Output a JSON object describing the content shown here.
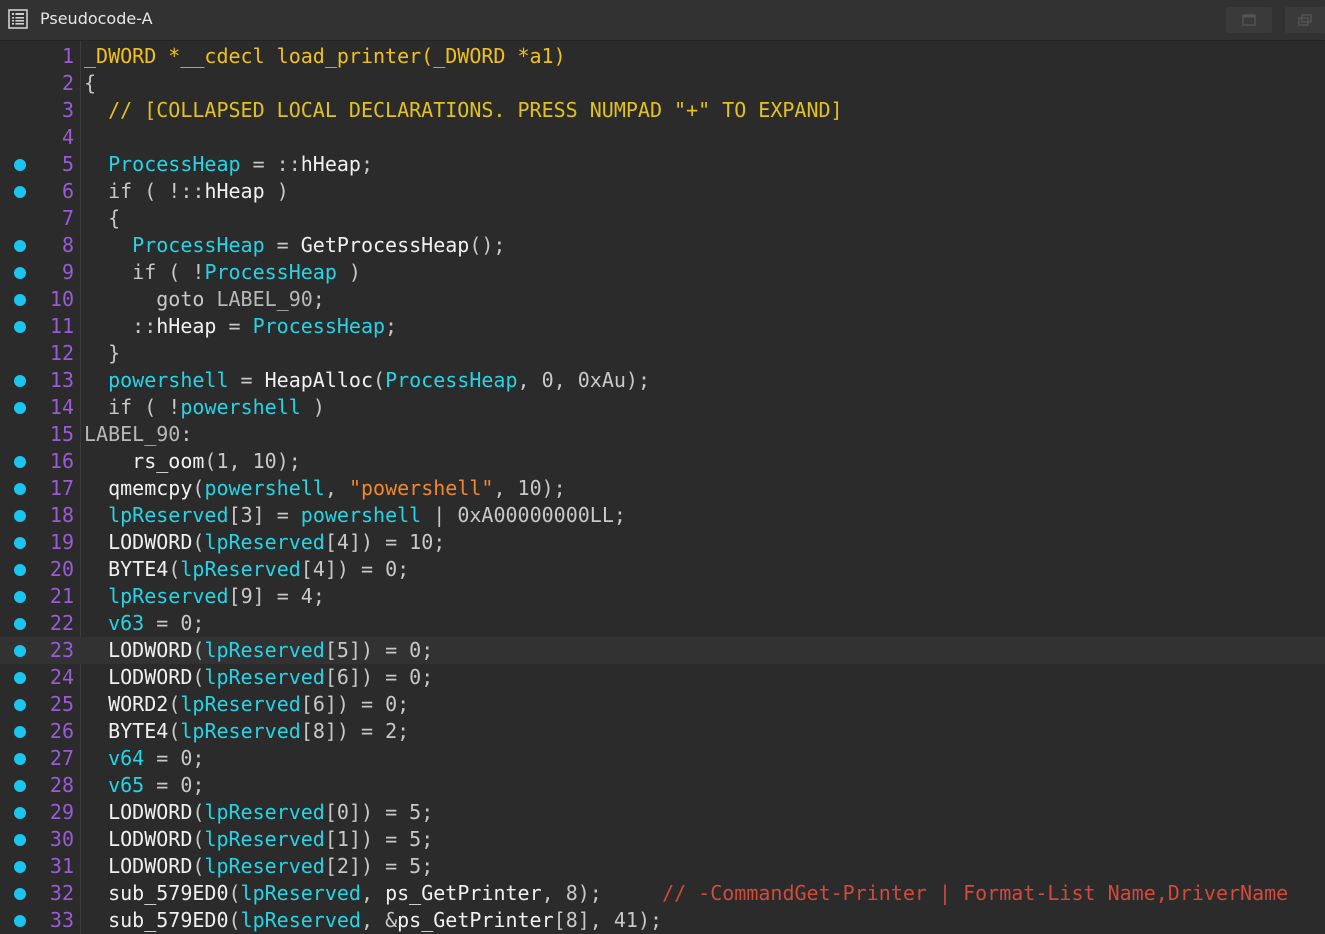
{
  "window": {
    "title": "Pseudocode-A"
  },
  "icons": {
    "title": "pseudocode-window-icon",
    "restore": "restore-window-icon",
    "float": "float-window-icon",
    "breakpoint_marker": "statement-dot-icon"
  },
  "colors": {
    "background": "#2b2b2b",
    "line_number": "#9a5cd6",
    "identifier": "#25d4e6",
    "collapsed_comment": "#e2c222",
    "inline_comment": "#d24a3c",
    "string": "#f0882c",
    "dot": "#1ac6f0"
  },
  "code": {
    "highlighted_line": 23,
    "lines": [
      {
        "n": "1",
        "dot": false,
        "segs": [
          {
            "c": "sig",
            "t": "_DWORD *__cdecl load_printer(_DWORD *a1)"
          }
        ]
      },
      {
        "n": "2",
        "dot": false,
        "segs": [
          {
            "c": "op",
            "t": "{"
          }
        ]
      },
      {
        "n": "3",
        "dot": false,
        "segs": [
          {
            "c": "op",
            "t": "  "
          },
          {
            "c": "cmt",
            "t": "// [COLLAPSED LOCAL DECLARATIONS. PRESS NUMPAD \"+\" TO EXPAND]"
          }
        ]
      },
      {
        "n": "4",
        "dot": false,
        "segs": []
      },
      {
        "n": "5",
        "dot": true,
        "segs": [
          {
            "c": "op",
            "t": "  "
          },
          {
            "c": "var",
            "t": "ProcessHeap"
          },
          {
            "c": "op",
            "t": " = ::"
          },
          {
            "c": "fn",
            "t": "hHeap"
          },
          {
            "c": "op",
            "t": ";"
          }
        ]
      },
      {
        "n": "6",
        "dot": true,
        "segs": [
          {
            "c": "op",
            "t": "  "
          },
          {
            "c": "kw",
            "t": "if"
          },
          {
            "c": "op",
            "t": " ( !::"
          },
          {
            "c": "fn",
            "t": "hHeap"
          },
          {
            "c": "op",
            "t": " )"
          }
        ]
      },
      {
        "n": "7",
        "dot": false,
        "segs": [
          {
            "c": "op",
            "t": "  {"
          }
        ]
      },
      {
        "n": "8",
        "dot": true,
        "segs": [
          {
            "c": "op",
            "t": "    "
          },
          {
            "c": "var",
            "t": "ProcessHeap"
          },
          {
            "c": "op",
            "t": " = "
          },
          {
            "c": "fn",
            "t": "GetProcessHeap"
          },
          {
            "c": "op",
            "t": "();"
          }
        ]
      },
      {
        "n": "9",
        "dot": true,
        "segs": [
          {
            "c": "op",
            "t": "    "
          },
          {
            "c": "kw",
            "t": "if"
          },
          {
            "c": "op",
            "t": " ( !"
          },
          {
            "c": "var",
            "t": "ProcessHeap"
          },
          {
            "c": "op",
            "t": " )"
          }
        ]
      },
      {
        "n": "10",
        "dot": true,
        "segs": [
          {
            "c": "op",
            "t": "      "
          },
          {
            "c": "kw",
            "t": "goto"
          },
          {
            "c": "op",
            "t": " "
          },
          {
            "c": "lbl",
            "t": "LABEL_90"
          },
          {
            "c": "op",
            "t": ";"
          }
        ]
      },
      {
        "n": "11",
        "dot": true,
        "segs": [
          {
            "c": "op",
            "t": "    ::"
          },
          {
            "c": "fn",
            "t": "hHeap"
          },
          {
            "c": "op",
            "t": " = "
          },
          {
            "c": "var",
            "t": "ProcessHeap"
          },
          {
            "c": "op",
            "t": ";"
          }
        ]
      },
      {
        "n": "12",
        "dot": false,
        "segs": [
          {
            "c": "op",
            "t": "  }"
          }
        ]
      },
      {
        "n": "13",
        "dot": true,
        "segs": [
          {
            "c": "op",
            "t": "  "
          },
          {
            "c": "var",
            "t": "powershell"
          },
          {
            "c": "op",
            "t": " = "
          },
          {
            "c": "fn",
            "t": "HeapAlloc"
          },
          {
            "c": "op",
            "t": "("
          },
          {
            "c": "var",
            "t": "ProcessHeap"
          },
          {
            "c": "op",
            "t": ", "
          },
          {
            "c": "num",
            "t": "0"
          },
          {
            "c": "op",
            "t": ", "
          },
          {
            "c": "num",
            "t": "0xAu"
          },
          {
            "c": "op",
            "t": ");"
          }
        ]
      },
      {
        "n": "14",
        "dot": true,
        "segs": [
          {
            "c": "op",
            "t": "  "
          },
          {
            "c": "kw",
            "t": "if"
          },
          {
            "c": "op",
            "t": " ( !"
          },
          {
            "c": "var",
            "t": "powershell"
          },
          {
            "c": "op",
            "t": " )"
          }
        ]
      },
      {
        "n": "15",
        "dot": false,
        "segs": [
          {
            "c": "lbl",
            "t": "LABEL_90"
          },
          {
            "c": "op",
            "t": ":"
          }
        ]
      },
      {
        "n": "16",
        "dot": true,
        "segs": [
          {
            "c": "op",
            "t": "    "
          },
          {
            "c": "fn",
            "t": "rs_oom"
          },
          {
            "c": "op",
            "t": "("
          },
          {
            "c": "num",
            "t": "1"
          },
          {
            "c": "op",
            "t": ", "
          },
          {
            "c": "num",
            "t": "10"
          },
          {
            "c": "op",
            "t": ");"
          }
        ]
      },
      {
        "n": "17",
        "dot": true,
        "segs": [
          {
            "c": "op",
            "t": "  "
          },
          {
            "c": "fn",
            "t": "qmemcpy"
          },
          {
            "c": "op",
            "t": "("
          },
          {
            "c": "var",
            "t": "powershell"
          },
          {
            "c": "op",
            "t": ", "
          },
          {
            "c": "str",
            "t": "\"powershell\""
          },
          {
            "c": "op",
            "t": ", "
          },
          {
            "c": "num",
            "t": "10"
          },
          {
            "c": "op",
            "t": ");"
          }
        ]
      },
      {
        "n": "18",
        "dot": true,
        "segs": [
          {
            "c": "op",
            "t": "  "
          },
          {
            "c": "var",
            "t": "lpReserved"
          },
          {
            "c": "op",
            "t": "["
          },
          {
            "c": "num",
            "t": "3"
          },
          {
            "c": "op",
            "t": "] = "
          },
          {
            "c": "var",
            "t": "powershell"
          },
          {
            "c": "op",
            "t": " | "
          },
          {
            "c": "num",
            "t": "0xA00000000LL"
          },
          {
            "c": "op",
            "t": ";"
          }
        ]
      },
      {
        "n": "19",
        "dot": true,
        "segs": [
          {
            "c": "op",
            "t": "  "
          },
          {
            "c": "fn",
            "t": "LODWORD"
          },
          {
            "c": "op",
            "t": "("
          },
          {
            "c": "var",
            "t": "lpReserved"
          },
          {
            "c": "op",
            "t": "["
          },
          {
            "c": "num",
            "t": "4"
          },
          {
            "c": "op",
            "t": "]) = "
          },
          {
            "c": "num",
            "t": "10"
          },
          {
            "c": "op",
            "t": ";"
          }
        ]
      },
      {
        "n": "20",
        "dot": true,
        "segs": [
          {
            "c": "op",
            "t": "  "
          },
          {
            "c": "fn",
            "t": "BYTE4"
          },
          {
            "c": "op",
            "t": "("
          },
          {
            "c": "var",
            "t": "lpReserved"
          },
          {
            "c": "op",
            "t": "["
          },
          {
            "c": "num",
            "t": "4"
          },
          {
            "c": "op",
            "t": "]) = "
          },
          {
            "c": "num",
            "t": "0"
          },
          {
            "c": "op",
            "t": ";"
          }
        ]
      },
      {
        "n": "21",
        "dot": true,
        "segs": [
          {
            "c": "op",
            "t": "  "
          },
          {
            "c": "var",
            "t": "lpReserved"
          },
          {
            "c": "op",
            "t": "["
          },
          {
            "c": "num",
            "t": "9"
          },
          {
            "c": "op",
            "t": "] = "
          },
          {
            "c": "num",
            "t": "4"
          },
          {
            "c": "op",
            "t": ";"
          }
        ]
      },
      {
        "n": "22",
        "dot": true,
        "segs": [
          {
            "c": "op",
            "t": "  "
          },
          {
            "c": "var",
            "t": "v63"
          },
          {
            "c": "op",
            "t": " = "
          },
          {
            "c": "num",
            "t": "0"
          },
          {
            "c": "op",
            "t": ";"
          }
        ]
      },
      {
        "n": "23",
        "dot": true,
        "segs": [
          {
            "c": "op",
            "t": "  "
          },
          {
            "c": "fn",
            "t": "LODWORD"
          },
          {
            "c": "op",
            "t": "("
          },
          {
            "c": "var",
            "t": "lpReserved"
          },
          {
            "c": "op",
            "t": "["
          },
          {
            "c": "num",
            "t": "5"
          },
          {
            "c": "op",
            "t": "]) = "
          },
          {
            "c": "num",
            "t": "0"
          },
          {
            "c": "op",
            "t": ";"
          }
        ]
      },
      {
        "n": "24",
        "dot": true,
        "segs": [
          {
            "c": "op",
            "t": "  "
          },
          {
            "c": "fn",
            "t": "LODWORD"
          },
          {
            "c": "op",
            "t": "("
          },
          {
            "c": "var",
            "t": "lpReserved"
          },
          {
            "c": "op",
            "t": "["
          },
          {
            "c": "num",
            "t": "6"
          },
          {
            "c": "op",
            "t": "]) = "
          },
          {
            "c": "num",
            "t": "0"
          },
          {
            "c": "op",
            "t": ";"
          }
        ]
      },
      {
        "n": "25",
        "dot": true,
        "segs": [
          {
            "c": "op",
            "t": "  "
          },
          {
            "c": "fn",
            "t": "WORD2"
          },
          {
            "c": "op",
            "t": "("
          },
          {
            "c": "var",
            "t": "lpReserved"
          },
          {
            "c": "op",
            "t": "["
          },
          {
            "c": "num",
            "t": "6"
          },
          {
            "c": "op",
            "t": "]) = "
          },
          {
            "c": "num",
            "t": "0"
          },
          {
            "c": "op",
            "t": ";"
          }
        ]
      },
      {
        "n": "26",
        "dot": true,
        "segs": [
          {
            "c": "op",
            "t": "  "
          },
          {
            "c": "fn",
            "t": "BYTE4"
          },
          {
            "c": "op",
            "t": "("
          },
          {
            "c": "var",
            "t": "lpReserved"
          },
          {
            "c": "op",
            "t": "["
          },
          {
            "c": "num",
            "t": "8"
          },
          {
            "c": "op",
            "t": "]) = "
          },
          {
            "c": "num",
            "t": "2"
          },
          {
            "c": "op",
            "t": ";"
          }
        ]
      },
      {
        "n": "27",
        "dot": true,
        "segs": [
          {
            "c": "op",
            "t": "  "
          },
          {
            "c": "var",
            "t": "v64"
          },
          {
            "c": "op",
            "t": " = "
          },
          {
            "c": "num",
            "t": "0"
          },
          {
            "c": "op",
            "t": ";"
          }
        ]
      },
      {
        "n": "28",
        "dot": true,
        "segs": [
          {
            "c": "op",
            "t": "  "
          },
          {
            "c": "var",
            "t": "v65"
          },
          {
            "c": "op",
            "t": " = "
          },
          {
            "c": "num",
            "t": "0"
          },
          {
            "c": "op",
            "t": ";"
          }
        ]
      },
      {
        "n": "29",
        "dot": true,
        "segs": [
          {
            "c": "op",
            "t": "  "
          },
          {
            "c": "fn",
            "t": "LODWORD"
          },
          {
            "c": "op",
            "t": "("
          },
          {
            "c": "var",
            "t": "lpReserved"
          },
          {
            "c": "op",
            "t": "["
          },
          {
            "c": "num",
            "t": "0"
          },
          {
            "c": "op",
            "t": "]) = "
          },
          {
            "c": "num",
            "t": "5"
          },
          {
            "c": "op",
            "t": ";"
          }
        ]
      },
      {
        "n": "30",
        "dot": true,
        "segs": [
          {
            "c": "op",
            "t": "  "
          },
          {
            "c": "fn",
            "t": "LODWORD"
          },
          {
            "c": "op",
            "t": "("
          },
          {
            "c": "var",
            "t": "lpReserved"
          },
          {
            "c": "op",
            "t": "["
          },
          {
            "c": "num",
            "t": "1"
          },
          {
            "c": "op",
            "t": "]) = "
          },
          {
            "c": "num",
            "t": "5"
          },
          {
            "c": "op",
            "t": ";"
          }
        ]
      },
      {
        "n": "31",
        "dot": true,
        "segs": [
          {
            "c": "op",
            "t": "  "
          },
          {
            "c": "fn",
            "t": "LODWORD"
          },
          {
            "c": "op",
            "t": "("
          },
          {
            "c": "var",
            "t": "lpReserved"
          },
          {
            "c": "op",
            "t": "["
          },
          {
            "c": "num",
            "t": "2"
          },
          {
            "c": "op",
            "t": "]) = "
          },
          {
            "c": "num",
            "t": "5"
          },
          {
            "c": "op",
            "t": ";"
          }
        ]
      },
      {
        "n": "32",
        "dot": true,
        "segs": [
          {
            "c": "op",
            "t": "  "
          },
          {
            "c": "fn",
            "t": "sub_579ED0"
          },
          {
            "c": "op",
            "t": "("
          },
          {
            "c": "var",
            "t": "lpReserved"
          },
          {
            "c": "op",
            "t": ", "
          },
          {
            "c": "fn",
            "t": "ps_GetPrinter"
          },
          {
            "c": "op",
            "t": ", "
          },
          {
            "c": "num",
            "t": "8"
          },
          {
            "c": "op",
            "t": ");     "
          },
          {
            "c": "rcmt",
            "t": "// -CommandGet-Printer | Format-List Name,DriverName"
          }
        ]
      },
      {
        "n": "33",
        "dot": true,
        "segs": [
          {
            "c": "op",
            "t": "  "
          },
          {
            "c": "fn",
            "t": "sub_579ED0"
          },
          {
            "c": "op",
            "t": "("
          },
          {
            "c": "var",
            "t": "lpReserved"
          },
          {
            "c": "op",
            "t": ", &"
          },
          {
            "c": "fn",
            "t": "ps_GetPrinter"
          },
          {
            "c": "op",
            "t": "["
          },
          {
            "c": "num",
            "t": "8"
          },
          {
            "c": "op",
            "t": "], "
          },
          {
            "c": "num",
            "t": "41"
          },
          {
            "c": "op",
            "t": ");"
          }
        ]
      }
    ]
  }
}
